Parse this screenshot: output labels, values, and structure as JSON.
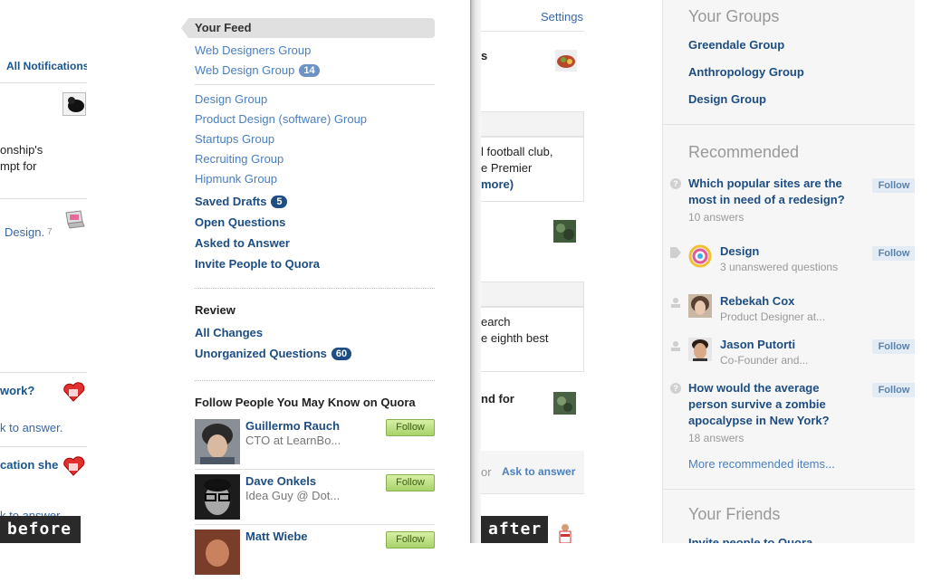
{
  "left_strip": {
    "notifications": "All Notifications",
    "snippet1": "onship's",
    "snippet2": "mpt for",
    "design_link": "Design.",
    "design_count": "7",
    "work_q": "work?",
    "ask_answer": "k to answer.",
    "cation": "cation she",
    "ask_answer2": "k to answer."
  },
  "sidebar": {
    "feed_tab": "Your Feed",
    "top_groups": [
      "Web Designers Group",
      "Web Design Group"
    ],
    "web_design_badge": "14",
    "groups": [
      "Design Group",
      "Product Design (software) Group",
      "Startups Group",
      "Recruiting Group",
      "Hipmunk Group"
    ],
    "saved_drafts": "Saved Drafts",
    "saved_drafts_badge": "5",
    "open_questions": "Open Questions",
    "asked_to_answer": "Asked to Answer",
    "invite": "Invite People to Quora",
    "review_heading": "Review",
    "all_changes": "All Changes",
    "unorganized": "Unorganized Questions",
    "unorganized_badge": "60",
    "follow_heading": "Follow People You May Know on Quora",
    "people": [
      {
        "name": "Guillermo Rauch",
        "desc": "CTO at LearnBo...",
        "button": "Follow"
      },
      {
        "name": "Dave Onkels",
        "desc": "Idea Guy @ Dot...",
        "button": "Follow"
      },
      {
        "name": "Matt Wiebe",
        "desc": "",
        "button": "Follow"
      }
    ]
  },
  "middle": {
    "settings": "Settings",
    "s_frag": "s",
    "football1": "l football club,",
    "football2": "e Premier",
    "more": "more)",
    "search1": "earch",
    "search2": "e eighth best",
    "nd_for": "nd for",
    "or": "or",
    "ask_to_answer": "Ask to answer"
  },
  "right": {
    "your_groups_heading": "Your Groups",
    "groups": [
      "Greendale Group",
      "Anthropology Group",
      "Design Group"
    ],
    "recommended_heading": "Recommended",
    "recommended": [
      {
        "title_l1": "Which popular sites are the",
        "title_l2": "most in need of a redesign?",
        "sub": "10 answers",
        "button": "Follow",
        "icon": "question-icon"
      },
      {
        "title_l1": "Design",
        "sub": "3 unanswered questions",
        "button": "Follow",
        "icon": "tag-icon"
      },
      {
        "title_l1": "Rebekah Cox",
        "sub": "Product Designer at...",
        "icon": "person-icon"
      },
      {
        "title_l1": "Jason Putorti",
        "sub": "Co-Founder and...",
        "button": "Follow",
        "icon": "person-icon"
      },
      {
        "title_l1": "How would the average",
        "title_l2": "person survive a zombie",
        "title_l3": "apocalypse in New York?",
        "sub": "18 answers",
        "button": "Follow",
        "icon": "question-icon"
      }
    ],
    "more_link": "More recommended items...",
    "friends_heading": "Your Friends",
    "invite_link": "Invite people to Quora"
  },
  "labels": {
    "before": "before",
    "after": "after"
  }
}
